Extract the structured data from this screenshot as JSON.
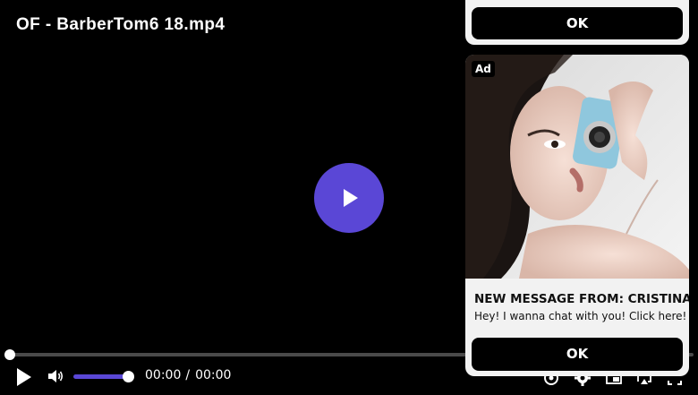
{
  "player": {
    "title": "OF - BarberTom6 18.mp4",
    "current_time": "00:00",
    "time_separator": "/",
    "duration": "00:00",
    "progress": 0,
    "volume": 1.0,
    "accent_color": "#5a47d6",
    "icons": {
      "big_play": "play-icon",
      "play": "play-icon",
      "volume": "volume-icon",
      "chromecast": "cast-icon",
      "settings": "gear-icon",
      "pip": "picture-in-picture-icon",
      "airplay": "airplay-icon",
      "fullscreen": "fullscreen-icon"
    }
  },
  "ads": {
    "top_card": {
      "ok_label": "OK"
    },
    "main_card": {
      "badge": "Ad",
      "headline": "NEW MESSAGE FROM: CRISTINA",
      "body": "Hey! I wanna chat with you! Click here!",
      "ok_label": "OK"
    }
  }
}
